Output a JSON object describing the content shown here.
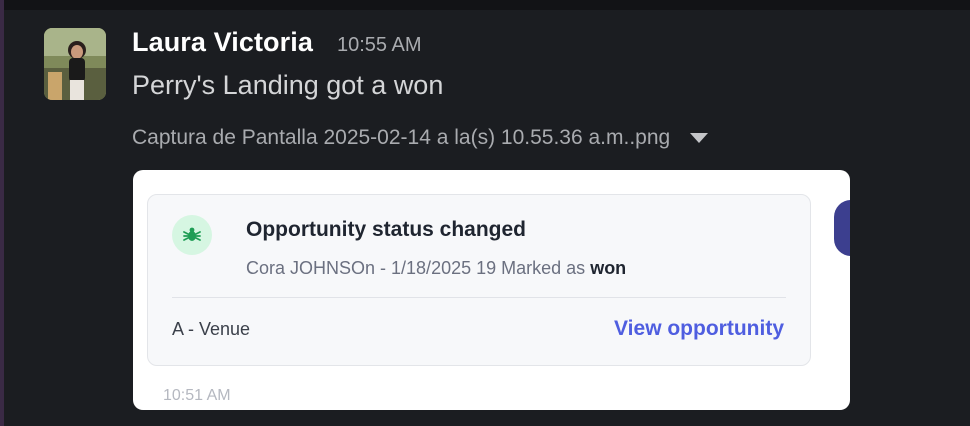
{
  "message": {
    "sender": "Laura Victoria",
    "time": "10:55 AM",
    "text": "Perry's Landing got a won",
    "attachment_name": "Captura de Pantalla 2025-02-14 a la(s) 10.55.36 a.m..png"
  },
  "card": {
    "title": "Opportunity status changed",
    "subtitle_prefix": "Cora JOHNSOn - 1/18/2025 19 Marked as",
    "subtitle_status": "won",
    "venue_label": "A - Venue",
    "link_label": "View opportunity",
    "timestamp": "10:51 AM"
  },
  "colors": {
    "background": "#1b1d21",
    "link": "#4f5ee0",
    "icon_bg": "#d6f6e2",
    "icon_fg": "#1f9d55"
  },
  "icons": {
    "status": "bug-icon",
    "expand": "caret-down-icon"
  }
}
